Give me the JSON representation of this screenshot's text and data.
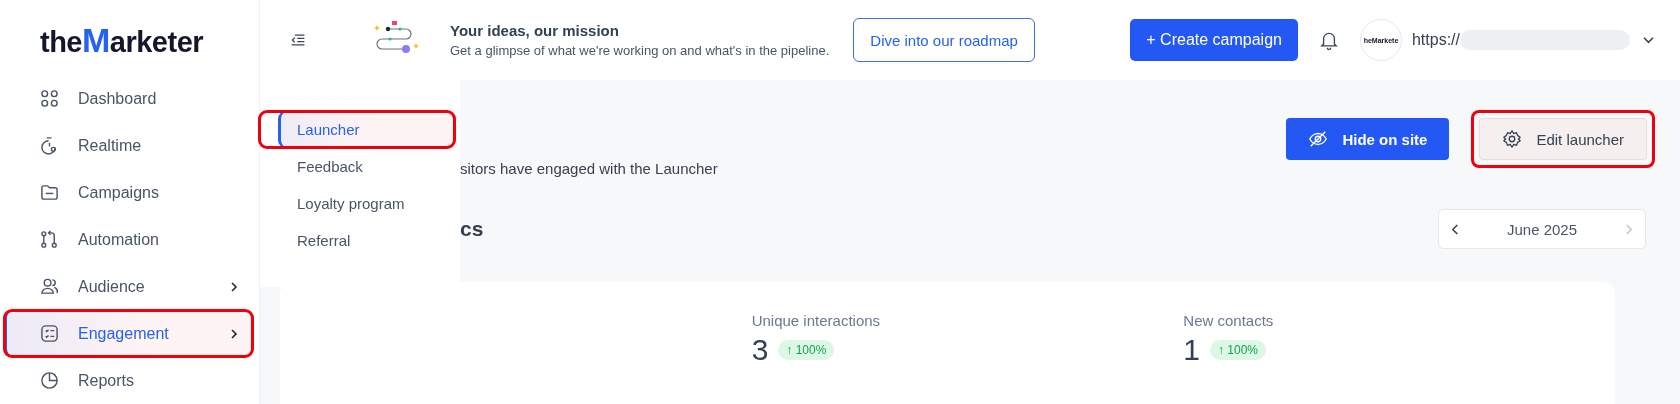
{
  "logo": {
    "prefix": "the",
    "accent": "M",
    "suffix": "arketer"
  },
  "nav": [
    {
      "label": "Dashboard",
      "selected": false,
      "has_submenu": false,
      "highlighted": false
    },
    {
      "label": "Realtime",
      "selected": false,
      "has_submenu": false,
      "highlighted": false
    },
    {
      "label": "Campaigns",
      "selected": false,
      "has_submenu": false,
      "highlighted": false
    },
    {
      "label": "Automation",
      "selected": false,
      "has_submenu": false,
      "highlighted": false
    },
    {
      "label": "Audience",
      "selected": false,
      "has_submenu": true,
      "highlighted": false
    },
    {
      "label": "Engagement",
      "selected": true,
      "has_submenu": true,
      "highlighted": true
    },
    {
      "label": "Reports",
      "selected": false,
      "has_submenu": false,
      "highlighted": false
    }
  ],
  "topbar": {
    "announcement_title": "Your ideas, our mission",
    "announcement_text": "Get a glimpse of what we're working on and what's in the pipeline.",
    "roadmap_button": "Dive into our roadmap",
    "create_button": "+ Create campaign",
    "avatar_text": "heMarkete",
    "account_url": "https://"
  },
  "submenu": [
    {
      "label": "Launcher",
      "selected": true,
      "highlighted": true
    },
    {
      "label": "Feedback",
      "selected": false,
      "highlighted": false
    },
    {
      "label": "Loyalty program",
      "selected": false,
      "highlighted": false
    },
    {
      "label": "Referral",
      "selected": false,
      "highlighted": false
    }
  ],
  "page": {
    "description": "sitors have engaged with the Launcher",
    "section_heading": "cs",
    "buttons": [
      {
        "label": "Hide on site",
        "kind": "primary",
        "highlighted": false
      },
      {
        "label": "Edit launcher",
        "kind": "secondary",
        "highlighted": true
      }
    ],
    "month_picker": {
      "label": "June 2025",
      "prev_disabled": false,
      "next_disabled": true
    },
    "metrics": [
      {
        "label": "Unique interactions",
        "value": "3",
        "change": "↑ 100%"
      },
      {
        "label": "New contacts",
        "value": "1",
        "change": "↑ 100%"
      }
    ]
  }
}
